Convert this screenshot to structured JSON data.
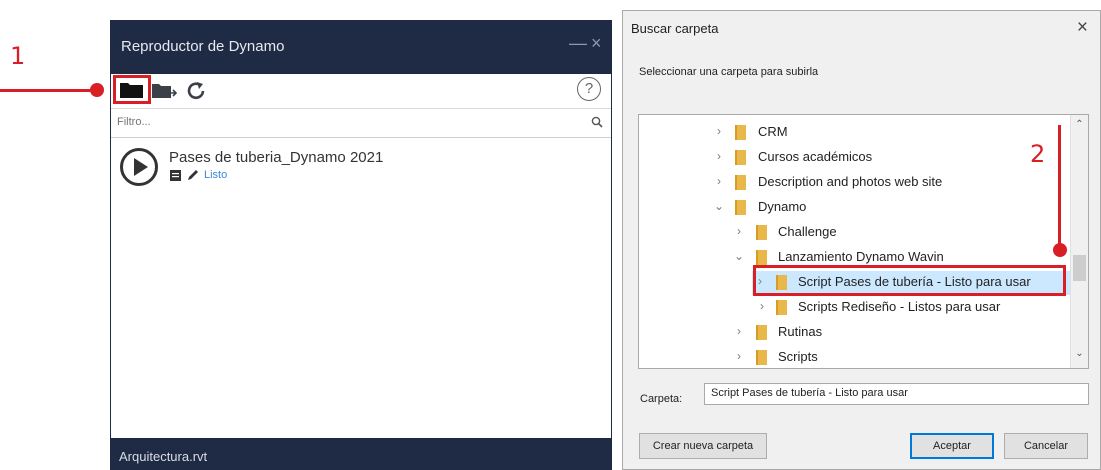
{
  "annotations": {
    "step1": "1",
    "step2": "2"
  },
  "player": {
    "title": "Reproductor de Dynamo",
    "minimize_glyph": "—",
    "close_glyph": "×",
    "help_glyph": "?",
    "filter_placeholder": "Filtro...",
    "script": {
      "name": "Pases de tuberia_Dynamo 2021",
      "status": "Listo"
    },
    "file_name": "Arquitectura.rvt",
    "colors": {
      "header": "#1f2a44",
      "status_link": "#3b86d6"
    },
    "icons": [
      "open-folder-icon",
      "export-folder-icon",
      "refresh-icon",
      "help-icon",
      "search-icon",
      "play-icon",
      "document-icon",
      "edit-icon"
    ]
  },
  "dialog": {
    "title": "Buscar carpeta",
    "close_glyph": "×",
    "description": "Seleccionar una carpeta para subirla",
    "tree": [
      {
        "label": "CRM",
        "expanded": false
      },
      {
        "label": "Cursos académicos",
        "expanded": false
      },
      {
        "label": "Description and photos web site",
        "expanded": false
      },
      {
        "label": "Dynamo",
        "expanded": true
      },
      {
        "label": "Challenge",
        "expanded": false
      },
      {
        "label": "Lanzamiento Dynamo Wavin",
        "expanded": true
      },
      {
        "label": "Script Pases de tubería - Listo para usar",
        "expanded": false,
        "selected": true
      },
      {
        "label": "Scripts Rediseño - Listos para usar",
        "expanded": false
      },
      {
        "label": "Rutinas",
        "expanded": false
      },
      {
        "label": "Scripts",
        "expanded": false
      }
    ],
    "folder_label": "Carpeta:",
    "folder_value": "Script Pases de tubería - Listo para usar",
    "buttons": {
      "new_folder": "Crear nueva carpeta",
      "accept": "Aceptar",
      "cancel": "Cancelar"
    }
  },
  "accent_color": "#d81f26"
}
